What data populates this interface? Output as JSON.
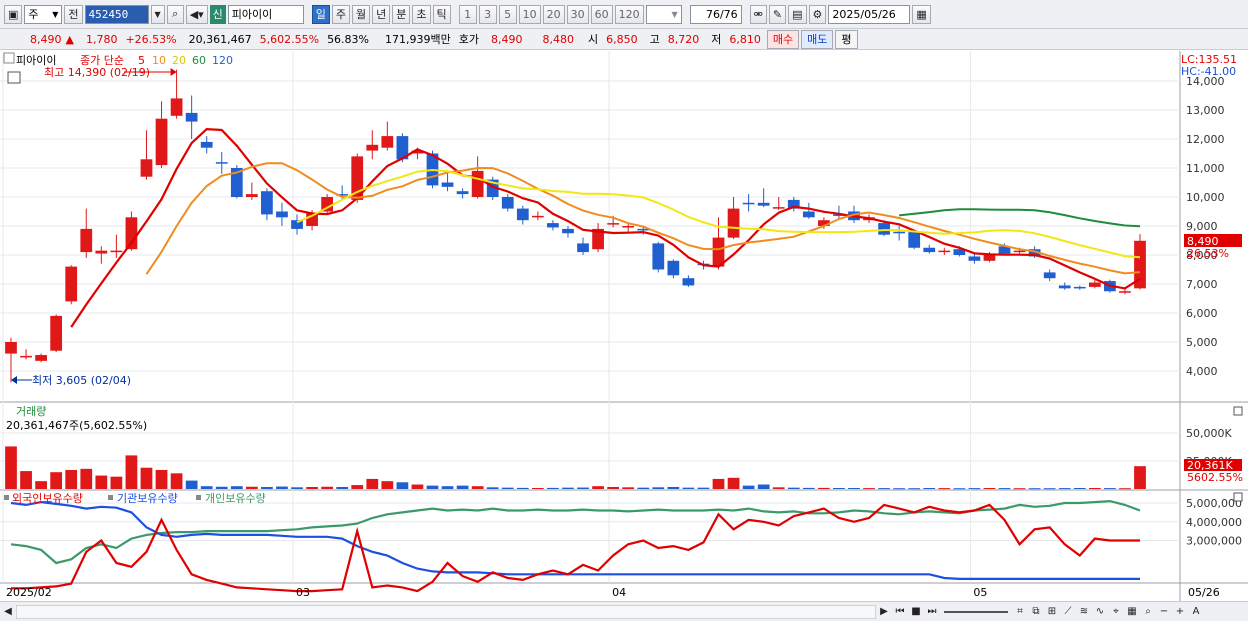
{
  "toolbar": {
    "market": "주",
    "prev_label": "전",
    "code": "452450",
    "new_badge": "신",
    "stock_name": "피아이이",
    "periods": [
      "일",
      "주",
      "월",
      "년",
      "분",
      "초",
      "틱"
    ],
    "active_period": "일",
    "intervals": [
      "1",
      "3",
      "5",
      "10",
      "20",
      "30",
      "60",
      "120"
    ],
    "count": "76",
    "count_total": "/76",
    "date": "2025/05/26"
  },
  "quote": {
    "price": "8,490",
    "change_arrow": "▲",
    "change": "1,780",
    "change_pct": "+26.53%",
    "volume": "20,361,467",
    "volume_ratio": "5,602.55%",
    "turnover": "56.83%",
    "amount": "171,939백만",
    "hoga_label": "호가",
    "ask": "8,490",
    "bid": "8,480",
    "open_label": "시",
    "open": "6,850",
    "high_label": "고",
    "high": "8,720",
    "low_label": "저",
    "low": "6,810",
    "buy_label": "매수",
    "sell_label": "매도",
    "eval_label": "평"
  },
  "price_panel": {
    "title": "피아이이",
    "ma_label": "종가 단순",
    "ma_periods": [
      "5",
      "10",
      "20",
      "60",
      "120"
    ],
    "ma_colors": [
      "#e00000",
      "#f08c1e",
      "#f2e614",
      "#1e8c3c",
      "#1e64d2"
    ],
    "high_note": "최고 14,390 (02/19)",
    "low_note": "최저 3,605 (02/04)",
    "lc": "LC:135.51",
    "hc": "HC:-41.00",
    "last_price_tag": "8,490",
    "last_pct_tag": "26.53%",
    "y_ticks": [
      "14,000",
      "13,000",
      "12,000",
      "11,000",
      "10,000",
      "9,000",
      "8,000",
      "7,000",
      "6,000",
      "5,000",
      "4,000"
    ]
  },
  "volume_panel": {
    "title": "거래량",
    "value": "20,361,467주(5,602.55%)",
    "y_ticks": [
      "50,000K",
      "25,000K"
    ],
    "last_tag": "20,361K",
    "last_pct": "5602.55%"
  },
  "holding_panel": {
    "legend": [
      "외국인보유수량",
      "기관보유수량",
      "개인보유수량"
    ],
    "legend_colors": [
      "#e00000",
      "#1e50e0",
      "#3a9a6a"
    ],
    "y_ticks": [
      "5,000,000",
      "4,000,000",
      "3,000,000"
    ]
  },
  "x_axis": {
    "labels": [
      "2025/02",
      "03",
      "04",
      "05"
    ],
    "end_label": "05/26"
  },
  "chart_data": {
    "type": "candlestick",
    "ylim": [
      3500,
      14500
    ],
    "candles": [
      {
        "o": 4600,
        "c": 5000,
        "h": 5150,
        "l": 3605
      },
      {
        "o": 4500,
        "c": 4520,
        "h": 4750,
        "l": 4400
      },
      {
        "o": 4350,
        "c": 4550,
        "h": 4600,
        "l": 4300
      },
      {
        "o": 4700,
        "c": 5900,
        "h": 5950,
        "l": 4650
      },
      {
        "o": 6400,
        "c": 7600,
        "h": 7650,
        "l": 6300
      },
      {
        "o": 8100,
        "c": 8900,
        "h": 9600,
        "l": 7900
      },
      {
        "o": 8050,
        "c": 8150,
        "h": 8300,
        "l": 7700
      },
      {
        "o": 8100,
        "c": 8150,
        "h": 8700,
        "l": 7900
      },
      {
        "o": 8200,
        "c": 9300,
        "h": 9500,
        "l": 8150
      },
      {
        "o": 10700,
        "c": 11300,
        "h": 12300,
        "l": 10600
      },
      {
        "o": 11100,
        "c": 12700,
        "h": 13300,
        "l": 11000
      },
      {
        "o": 12800,
        "c": 13400,
        "h": 14390,
        "l": 12700
      },
      {
        "o": 12900,
        "c": 12600,
        "h": 13500,
        "l": 12000
      },
      {
        "o": 11900,
        "c": 11700,
        "h": 12100,
        "l": 11500
      },
      {
        "o": 11200,
        "c": 11150,
        "h": 11550,
        "l": 10800
      },
      {
        "o": 11000,
        "c": 10000,
        "h": 11100,
        "l": 9950
      },
      {
        "o": 10000,
        "c": 10100,
        "h": 10500,
        "l": 9900
      },
      {
        "o": 10200,
        "c": 9400,
        "h": 10300,
        "l": 9200
      },
      {
        "o": 9500,
        "c": 9300,
        "h": 9800,
        "l": 9000
      },
      {
        "o": 9200,
        "c": 8900,
        "h": 9400,
        "l": 8700
      },
      {
        "o": 9000,
        "c": 9450,
        "h": 9550,
        "l": 8850
      },
      {
        "o": 9500,
        "c": 10000,
        "h": 10100,
        "l": 9400
      },
      {
        "o": 10100,
        "c": 10050,
        "h": 10400,
        "l": 9900
      },
      {
        "o": 9900,
        "c": 11400,
        "h": 11500,
        "l": 9800
      },
      {
        "o": 11600,
        "c": 11800,
        "h": 12300,
        "l": 11300
      },
      {
        "o": 11700,
        "c": 12100,
        "h": 12600,
        "l": 11600
      },
      {
        "o": 12100,
        "c": 11300,
        "h": 12200,
        "l": 11200
      },
      {
        "o": 11500,
        "c": 11600,
        "h": 11700,
        "l": 11300
      },
      {
        "o": 11500,
        "c": 10400,
        "h": 11600,
        "l": 10300
      },
      {
        "o": 10500,
        "c": 10350,
        "h": 10900,
        "l": 10200
      },
      {
        "o": 10200,
        "c": 10100,
        "h": 10300,
        "l": 9950
      },
      {
        "o": 10000,
        "c": 10900,
        "h": 11400,
        "l": 9950
      },
      {
        "o": 10600,
        "c": 10000,
        "h": 10700,
        "l": 9900
      },
      {
        "o": 10000,
        "c": 9600,
        "h": 10100,
        "l": 9500
      },
      {
        "o": 9600,
        "c": 9200,
        "h": 9700,
        "l": 9050
      },
      {
        "o": 9300,
        "c": 9350,
        "h": 9500,
        "l": 9200
      },
      {
        "o": 9100,
        "c": 8950,
        "h": 9200,
        "l": 8850
      },
      {
        "o": 8900,
        "c": 8750,
        "h": 9000,
        "l": 8600
      },
      {
        "o": 8400,
        "c": 8100,
        "h": 8600,
        "l": 8000
      },
      {
        "o": 8200,
        "c": 8900,
        "h": 9100,
        "l": 8100
      },
      {
        "o": 9100,
        "c": 9100,
        "h": 9350,
        "l": 8950
      },
      {
        "o": 8950,
        "c": 9000,
        "h": 9100,
        "l": 8800
      },
      {
        "o": 8900,
        "c": 8850,
        "h": 9000,
        "l": 8700
      },
      {
        "o": 8400,
        "c": 7500,
        "h": 8450,
        "l": 7400
      },
      {
        "o": 7800,
        "c": 7300,
        "h": 7850,
        "l": 7200
      },
      {
        "o": 7200,
        "c": 6950,
        "h": 7300,
        "l": 6900
      },
      {
        "o": 7700,
        "c": 7650,
        "h": 7800,
        "l": 7500
      },
      {
        "o": 7600,
        "c": 8600,
        "h": 9300,
        "l": 7500
      },
      {
        "o": 8600,
        "c": 9600,
        "h": 10000,
        "l": 8550
      },
      {
        "o": 9800,
        "c": 9750,
        "h": 10100,
        "l": 9500
      },
      {
        "o": 9800,
        "c": 9700,
        "h": 10300,
        "l": 9650
      },
      {
        "o": 9600,
        "c": 9650,
        "h": 10000,
        "l": 9550
      },
      {
        "o": 9900,
        "c": 9600,
        "h": 10000,
        "l": 9500
      },
      {
        "o": 9500,
        "c": 9300,
        "h": 9800,
        "l": 9250
      },
      {
        "o": 9000,
        "c": 9200,
        "h": 9300,
        "l": 8900
      },
      {
        "o": 9400,
        "c": 9350,
        "h": 9700,
        "l": 9250
      },
      {
        "o": 9500,
        "c": 9200,
        "h": 9700,
        "l": 9100
      },
      {
        "o": 9200,
        "c": 9300,
        "h": 9400,
        "l": 9100
      },
      {
        "o": 9100,
        "c": 8700,
        "h": 9200,
        "l": 8650
      },
      {
        "o": 8800,
        "c": 8750,
        "h": 9000,
        "l": 8500
      },
      {
        "o": 8800,
        "c": 8250,
        "h": 8850,
        "l": 8200
      },
      {
        "o": 8250,
        "c": 8100,
        "h": 8350,
        "l": 8050
      },
      {
        "o": 8100,
        "c": 8150,
        "h": 8250,
        "l": 8000
      },
      {
        "o": 8200,
        "c": 8000,
        "h": 8300,
        "l": 7950
      },
      {
        "o": 7950,
        "c": 7800,
        "h": 8100,
        "l": 7700
      },
      {
        "o": 7800,
        "c": 8050,
        "h": 8100,
        "l": 7750
      },
      {
        "o": 8300,
        "c": 8050,
        "h": 8400,
        "l": 8000
      },
      {
        "o": 8150,
        "c": 8150,
        "h": 8250,
        "l": 8050
      },
      {
        "o": 8200,
        "c": 7950,
        "h": 8300,
        "l": 7900
      },
      {
        "o": 7400,
        "c": 7200,
        "h": 7500,
        "l": 7100
      },
      {
        "o": 6950,
        "c": 6850,
        "h": 7050,
        "l": 6800
      },
      {
        "o": 6900,
        "c": 6850,
        "h": 6950,
        "l": 6800
      },
      {
        "o": 6900,
        "c": 7050,
        "h": 7200,
        "l": 6850
      },
      {
        "o": 7100,
        "c": 6750,
        "h": 7150,
        "l": 6700
      },
      {
        "o": 6750,
        "c": 6750,
        "h": 6900,
        "l": 6650
      },
      {
        "o": 6850,
        "c": 8490,
        "h": 8720,
        "l": 6810
      }
    ],
    "volume_k": [
      38000,
      16000,
      7000,
      15000,
      17000,
      18000,
      12000,
      11000,
      30000,
      19000,
      17000,
      14000,
      7500,
      2500,
      2000,
      2500,
      2000,
      1800,
      2200,
      1500,
      1800,
      2000,
      1800,
      3500,
      9000,
      7000,
      6000,
      4000,
      3000,
      2500,
      3000,
      2500,
      1500,
      1200,
      1000,
      900,
      1000,
      1200,
      1300,
      2500,
      1800,
      1500,
      1200,
      1500,
      1800,
      1200,
      1200,
      9000,
      10000,
      3000,
      4000,
      1500,
      1200,
      1000,
      1000,
      900,
      900,
      800,
      800,
      700,
      700,
      900,
      800,
      700,
      800,
      900,
      800,
      700,
      700,
      700,
      800,
      900,
      900,
      800,
      700,
      20361
    ],
    "holdings": {
      "foreign": [
        0.45,
        0.45,
        0.5,
        0.55,
        0.7,
        2.4,
        3.0,
        1.8,
        1.6,
        2.4,
        4.1,
        2.5,
        1.2,
        0.9,
        0.7,
        0.5,
        0.45,
        0.4,
        0.35,
        0.3,
        0.3,
        0.35,
        0.4,
        3.5,
        0.5,
        0.6,
        0.5,
        0.3,
        0.8,
        1.8,
        1.1,
        0.8,
        1.3,
        1.0,
        0.9,
        1.2,
        1.4,
        1.2,
        1.7,
        1.4,
        2.2,
        2.8,
        3.0,
        2.6,
        2.7,
        2.5,
        2.9,
        4.4,
        3.6,
        4.1,
        4.0,
        3.8,
        4.3,
        4.5,
        4.7,
        4.2,
        4.0,
        4.2,
        4.9,
        4.7,
        4.5,
        4.8,
        4.6,
        4.5,
        4.6,
        4.9,
        4.1,
        2.8,
        3.6,
        3.7,
        2.8,
        2.2,
        3.1,
        3.0,
        3.0,
        3.0
      ],
      "institution": [
        5.0,
        4.9,
        5.05,
        4.95,
        4.85,
        4.7,
        4.8,
        4.75,
        4.5,
        3.7,
        3.3,
        3.2,
        3.3,
        3.35,
        3.3,
        3.3,
        3.3,
        3.3,
        3.25,
        3.2,
        3.2,
        3.2,
        3.1,
        2.7,
        2.4,
        2.2,
        1.8,
        1.5,
        1.35,
        1.3,
        1.3,
        1.3,
        1.25,
        1.2,
        1.2,
        1.2,
        1.2,
        1.2,
        1.2,
        1.2,
        1.2,
        1.2,
        1.2,
        1.2,
        1.2,
        1.2,
        1.2,
        1.2,
        1.2,
        1.2,
        1.2,
        1.2,
        1.2,
        1.2,
        1.2,
        1.2,
        1.2,
        1.2,
        1.2,
        1.2,
        1.2,
        1.2,
        1.0,
        0.95,
        0.95,
        0.95,
        0.95,
        0.95,
        0.95,
        0.95,
        0.95,
        0.95,
        0.95,
        0.95,
        0.95,
        0.95
      ],
      "individual": [
        2.8,
        2.7,
        2.5,
        1.8,
        2.0,
        2.6,
        2.8,
        2.6,
        3.1,
        3.3,
        3.4,
        3.45,
        3.45,
        3.5,
        3.5,
        3.5,
        3.5,
        3.5,
        3.55,
        3.6,
        3.7,
        3.75,
        3.8,
        3.9,
        4.2,
        4.4,
        4.5,
        4.6,
        4.7,
        4.6,
        4.65,
        4.6,
        4.7,
        4.6,
        4.6,
        4.65,
        4.6,
        4.6,
        4.65,
        4.6,
        4.6,
        4.55,
        4.6,
        4.65,
        4.6,
        4.6,
        4.6,
        4.65,
        4.6,
        4.7,
        4.55,
        4.5,
        4.55,
        4.45,
        4.45,
        4.5,
        4.6,
        4.55,
        4.45,
        4.4,
        4.5,
        4.55,
        4.5,
        4.45,
        4.6,
        4.65,
        4.7,
        4.9,
        4.8,
        4.85,
        5.0,
        5.0,
        5.05,
        5.1,
        4.9,
        4.6
      ],
      "unit": "백만"
    }
  }
}
